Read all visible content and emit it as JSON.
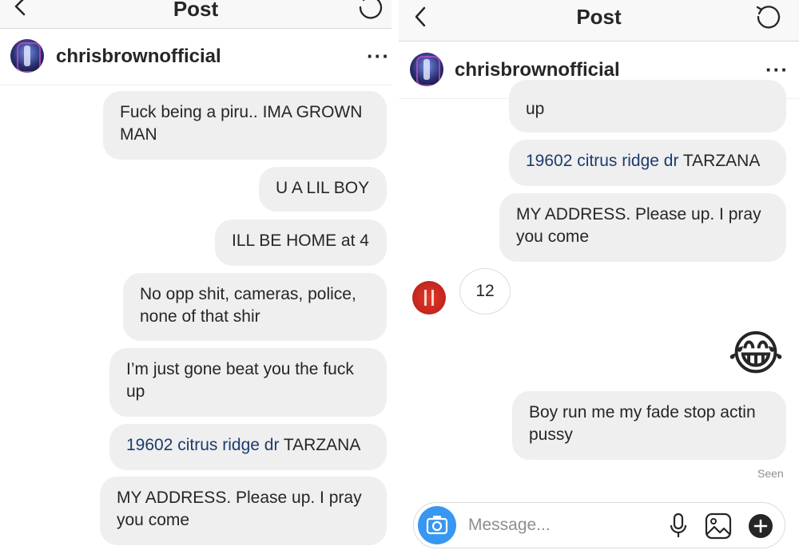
{
  "left": {
    "title": "Post",
    "username": "chrisbrownofficial",
    "messages": [
      {
        "text": "Fuck being a piru.. IMA GROWN MAN"
      },
      {
        "text": "U A LIL BOY"
      },
      {
        "text": "ILL BE HOME at 4"
      },
      {
        "text": "No opp shit, cameras, police, none of that shir"
      },
      {
        "text": "I’m just gone beat you the fuck up"
      },
      {
        "link": "19602 citrus ridge dr",
        "rest": " TARZANA"
      },
      {
        "text": "MY ADDRESS.  Please up. I pray you come"
      }
    ]
  },
  "right": {
    "title": "Post",
    "username": "chrisbrownofficial",
    "messages": [
      {
        "text": "up"
      },
      {
        "link": "19602 citrus ridge dr",
        "rest": " TARZANA"
      },
      {
        "text": "MY ADDRESS.  Please up. I pray you come"
      },
      {
        "text": "12"
      },
      {
        "emoji": "😂"
      },
      {
        "text": "Boy run me my fade stop actin pussy"
      }
    ],
    "seen": "Seen",
    "composer": {
      "placeholder": "Message..."
    }
  },
  "colors": {
    "bubble": "#efefef",
    "link": "#1c3c6e",
    "camera": "#3897f0",
    "nav": "#f8f8f8"
  },
  "icons": [
    "back-chevron-icon",
    "refresh-icon",
    "more-icon",
    "camera-icon",
    "microphone-icon",
    "gallery-icon",
    "add-icon"
  ]
}
